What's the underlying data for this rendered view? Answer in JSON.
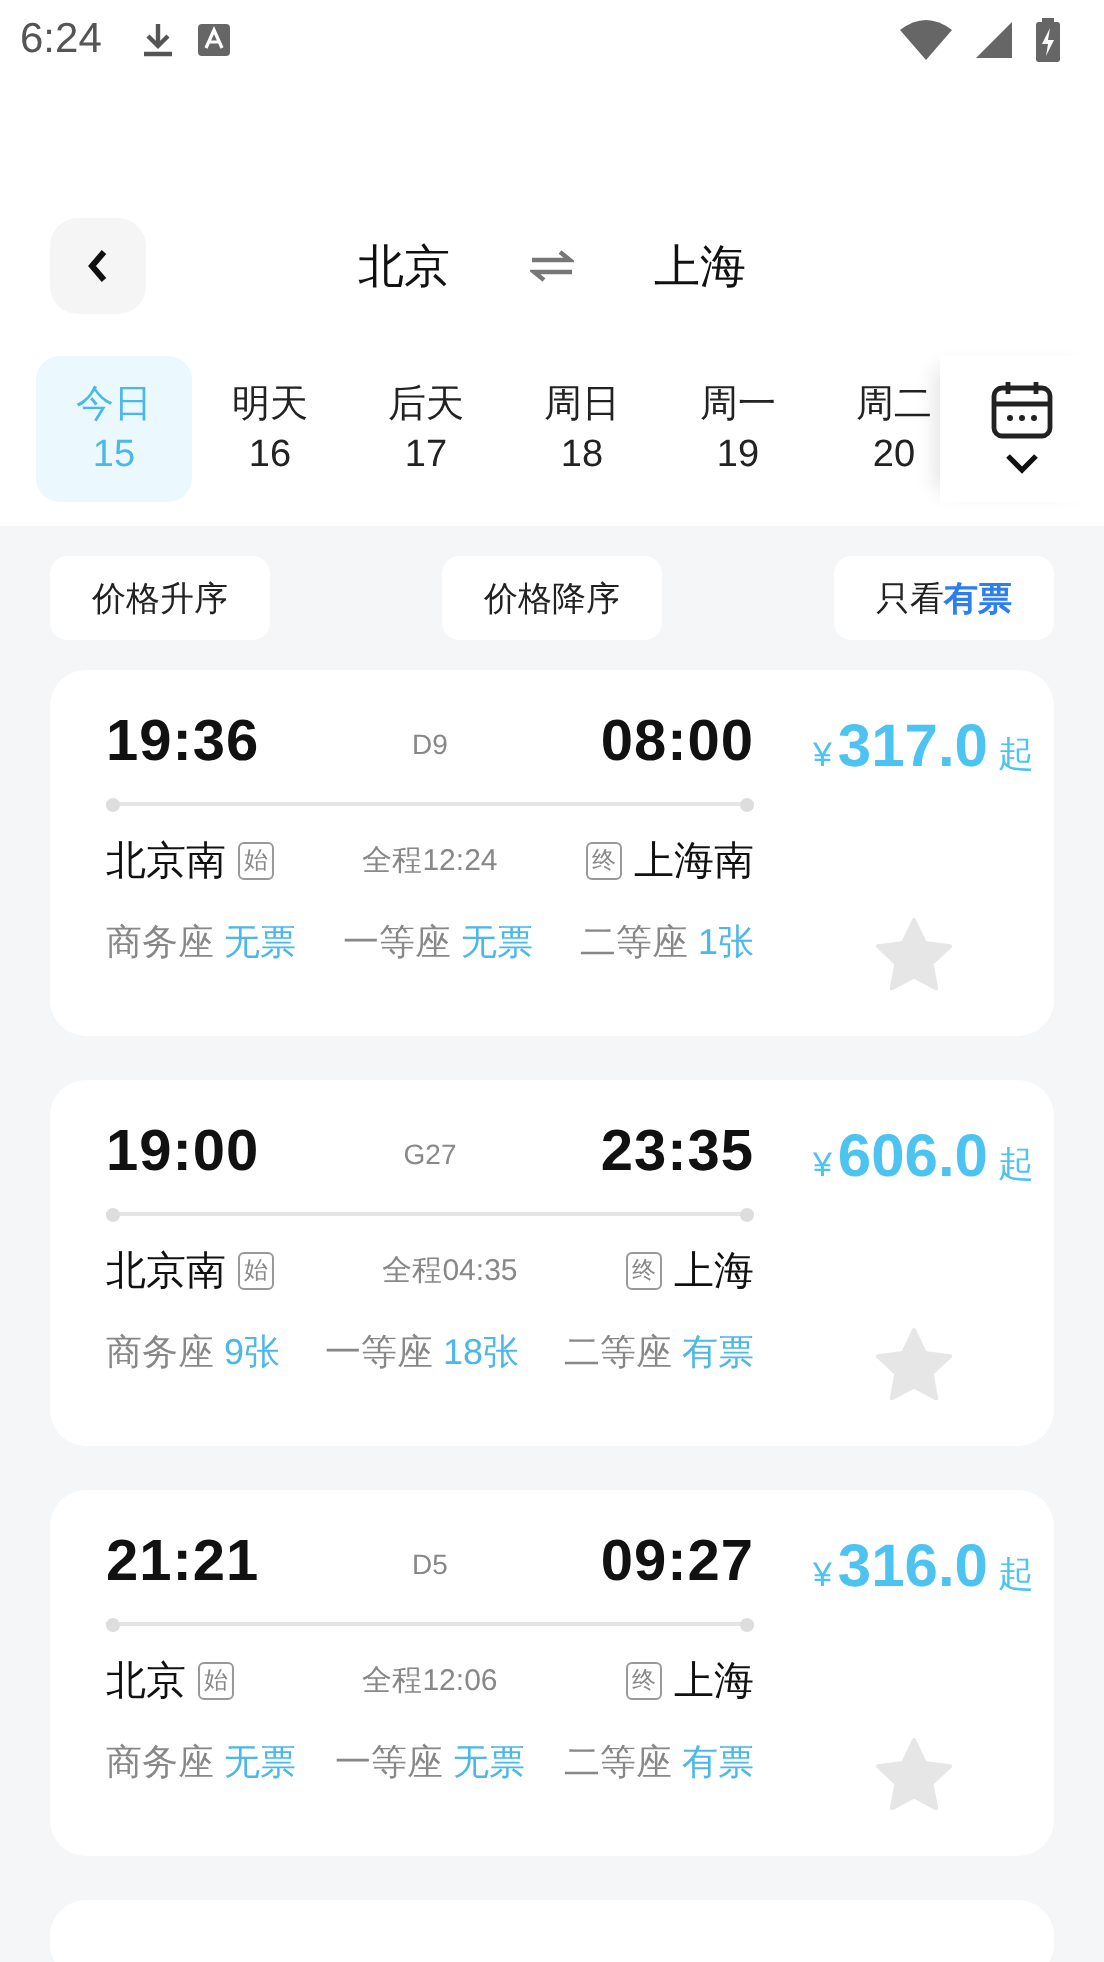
{
  "status_bar": {
    "time": "6:24"
  },
  "header": {
    "from": "北京",
    "to": "上海"
  },
  "dates": [
    {
      "day": "今日",
      "date": "15",
      "selected": true
    },
    {
      "day": "明天",
      "date": "16",
      "selected": false
    },
    {
      "day": "后天",
      "date": "17",
      "selected": false
    },
    {
      "day": "周日",
      "date": "18",
      "selected": false
    },
    {
      "day": "周一",
      "date": "19",
      "selected": false
    },
    {
      "day": "周二",
      "date": "20",
      "selected": false
    }
  ],
  "filters": [
    "价格升序",
    "价格降序",
    "只看**有票**"
  ],
  "trains": [
    {
      "depart": "19:36",
      "number": "D9",
      "arrive": "08:00",
      "price_symbol": "¥",
      "price": "317.0",
      "price_suffix": "起",
      "from": "北京南",
      "from_tag": "始",
      "duration": "全程12:24",
      "to_tag": "终",
      "to": "上海南",
      "favorite": false,
      "seats": [
        {
          "label": "商务座",
          "value": "无票"
        },
        {
          "label": "一等座",
          "value": "无票"
        },
        {
          "label": "二等座",
          "value": "1张"
        }
      ]
    },
    {
      "depart": "19:00",
      "number": "G27",
      "arrive": "23:35",
      "price_symbol": "¥",
      "price": "606.0",
      "price_suffix": "起",
      "from": "北京南",
      "from_tag": "始",
      "duration": "全程04:35",
      "to_tag": "终",
      "to": "上海",
      "favorite": false,
      "seats": [
        {
          "label": "商务座",
          "value": "9张"
        },
        {
          "label": "一等座",
          "value": "18张"
        },
        {
          "label": "二等座",
          "value": "有票"
        }
      ]
    },
    {
      "depart": "21:21",
      "number": "D5",
      "arrive": "09:27",
      "price_symbol": "¥",
      "price": "316.0",
      "price_suffix": "起",
      "from": "北京",
      "from_tag": "始",
      "duration": "全程12:06",
      "to_tag": "终",
      "to": "上海",
      "favorite": false,
      "seats": [
        {
          "label": "商务座",
          "value": "无票"
        },
        {
          "label": "一等座",
          "value": "无票"
        },
        {
          "label": "二等座",
          "value": "有票"
        }
      ]
    },
    {
      "kind": "cut"
    }
  ]
}
